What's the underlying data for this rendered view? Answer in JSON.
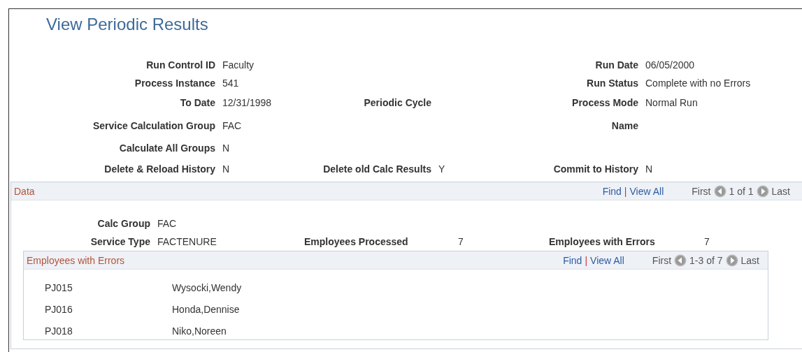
{
  "title": "View Periodic Results",
  "header_rows": [
    {
      "left": {
        "label": "Run Control ID",
        "value": "Faculty"
      },
      "right": {
        "label": "Run Date",
        "value": "06/05/2000"
      }
    },
    {
      "left": {
        "label": "Process Instance",
        "value": "541"
      },
      "right": {
        "label": "Run Status",
        "value": "Complete with no Errors"
      }
    },
    {
      "left": {
        "label": "To Date",
        "value": "12/31/1998"
      },
      "middle": {
        "label": "Periodic Cycle"
      },
      "right": {
        "label": "Process Mode",
        "value": "Normal Run"
      }
    },
    {
      "left": {
        "label": "Service Calculation Group",
        "value": "FAC"
      },
      "right": {
        "label": "Name"
      }
    },
    {
      "left": {
        "label": "Calculate All Groups",
        "value": "N"
      }
    },
    {
      "left": {
        "label": "Delete & Reload History",
        "value": "N"
      },
      "middle": {
        "label": "Delete old Calc Results",
        "value": "Y"
      },
      "right": {
        "label": "Commit to History",
        "value": "N"
      }
    }
  ],
  "data_panel": {
    "title": "Data",
    "find": "Find",
    "separator": "|",
    "view_all": "View All",
    "first": "First",
    "range": "1 of 1",
    "last": "Last",
    "rows": [
      {
        "left": {
          "label": "Calc Group",
          "value": "FAC"
        }
      },
      {
        "left": {
          "label": "Service Type",
          "value": "FACTENURE"
        },
        "middle": {
          "label": "Employees Processed",
          "value": "7"
        },
        "right": {
          "label": "Employees with Errors",
          "value": "7"
        }
      }
    ],
    "errors_grid": {
      "title": "Employees with Errors",
      "find": "Find",
      "separator": "|",
      "view_all": "View All",
      "first": "First",
      "range": "1-3 of 7",
      "last": "Last",
      "rows": [
        {
          "id": "PJ015",
          "name": "Wysocki,Wendy"
        },
        {
          "id": "PJ016",
          "name": "Honda,Dennise"
        },
        {
          "id": "PJ018",
          "name": "Niko,Noreen"
        }
      ]
    }
  }
}
